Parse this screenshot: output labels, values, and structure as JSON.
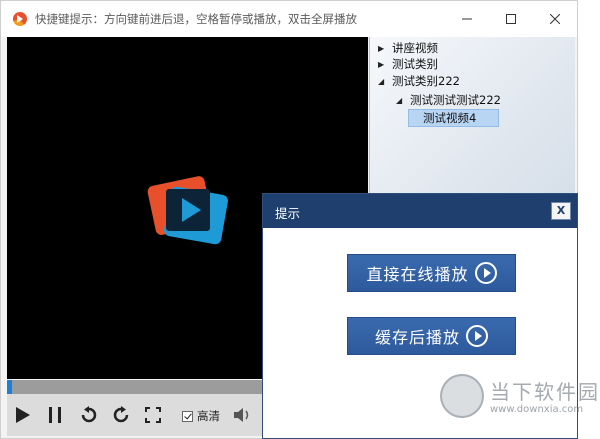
{
  "window": {
    "title": "快捷键提示：方向键前进后退，空格暂停或播放，双击全屏播放"
  },
  "icons": {
    "app": "player-app-icon",
    "minimize": "minimize-icon",
    "maximize": "maximize-icon",
    "close": "close-icon"
  },
  "playlist": {
    "items": [
      {
        "label": "讲座视频",
        "expanded": false,
        "level": 0
      },
      {
        "label": "测试类别",
        "expanded": false,
        "level": 0
      },
      {
        "label": "测试类别222",
        "expanded": true,
        "level": 0
      },
      {
        "label": "测试测试测试222",
        "expanded": true,
        "level": 1
      },
      {
        "label": "测试视频4",
        "selected": true,
        "level": 2
      }
    ]
  },
  "player": {
    "progress": 0.02,
    "hd_label": "高清",
    "hd_checked": true
  },
  "dialog": {
    "title": "提示",
    "close_label": "X",
    "play_online_label": "直接在线播放",
    "play_cached_label": "缓存后播放"
  },
  "watermark": {
    "text": "当下软件园",
    "url": "www.downxia.com"
  },
  "colors": {
    "dialog_header": "#1f3f6e",
    "dialog_button": "#2d5a9c",
    "progress_fill": "#1e7fd8",
    "logo_orange": "#e8502c",
    "logo_blue": "#1e9ad6"
  }
}
